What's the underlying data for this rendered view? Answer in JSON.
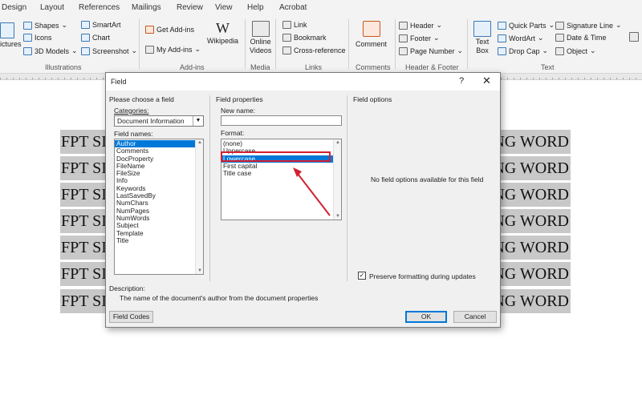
{
  "ribbon": {
    "tabs": [
      "Design",
      "Layout",
      "References",
      "Mailings",
      "Review",
      "View",
      "Help",
      "Acrobat"
    ],
    "illustrations": {
      "pictures": "ictures",
      "shapes": "Shapes",
      "icons": "Icons",
      "models": "3D Models",
      "smartart": "SmartArt",
      "chart": "Chart",
      "screenshot": "Screenshot",
      "group": "Illustrations"
    },
    "addins": {
      "get": "Get Add-ins",
      "my": "My Add-ins",
      "wikipedia": "Wikipedia",
      "group": "Add-ins"
    },
    "media": {
      "video_1": "Online",
      "video_2": "Videos",
      "group": "Media"
    },
    "links": {
      "link": "Link",
      "bookmark": "Bookmark",
      "crossref": "Cross-reference",
      "group": "Links"
    },
    "comments": {
      "comment": "Comment",
      "group": "Comments"
    },
    "headerfooter": {
      "header": "Header",
      "footer": "Footer",
      "pagenumber": "Page Number",
      "group": "Header & Footer"
    },
    "text": {
      "textbox_1": "Text",
      "textbox_2": "Box",
      "quickparts": "Quick Parts",
      "wordart": "WordArt",
      "dropcap": "Drop Cap",
      "signature": "Signature Line",
      "datetime": "Date & Time",
      "object": "Object",
      "group": "Text"
    }
  },
  "document": {
    "line_left": "FPT SI",
    "line_right": "NG WORD",
    "line_count": 7
  },
  "dialog": {
    "title": "Field",
    "help": "?",
    "close": "✕",
    "choose_heading": "Please choose a field",
    "categories_label": "Categories:",
    "categories_value": "Document Information",
    "field_names_label": "Field names:",
    "field_names": [
      "Author",
      "Comments",
      "DocProperty",
      "FileName",
      "FileSize",
      "Info",
      "Keywords",
      "LastSavedBy",
      "NumChars",
      "NumPages",
      "NumWords",
      "Subject",
      "Template",
      "Title"
    ],
    "field_names_selected": "Author",
    "properties_heading": "Field properties",
    "new_name_label": "New name:",
    "format_label": "Format:",
    "formats": [
      "(none)",
      "Uppercase",
      "Lowercase",
      "First capital",
      "Title case"
    ],
    "format_selected": "Lowercase",
    "options_heading": "Field options",
    "no_options": "No field options available for this field",
    "preserve_label": "Preserve formatting during updates",
    "preserve_checked": true,
    "description_label": "Description:",
    "description_text": "The name of the document's author from the document properties",
    "field_codes_button": "Field Codes",
    "ok_button": "OK",
    "cancel_button": "Cancel"
  },
  "colors": {
    "selection": "#0078d7",
    "annotation": "#d32030",
    "doc_highlight": "#c8c8c8"
  }
}
